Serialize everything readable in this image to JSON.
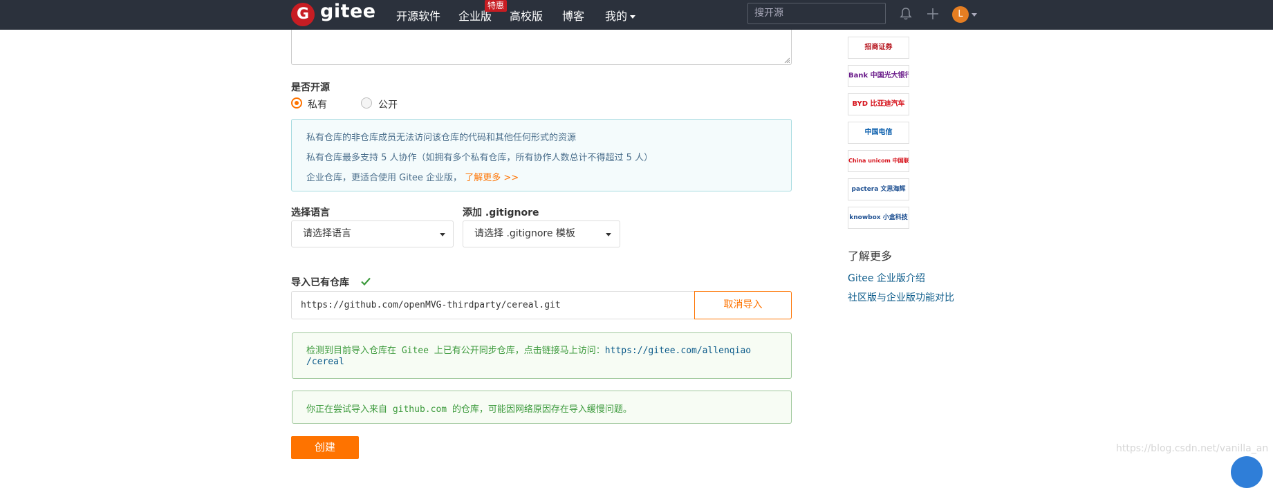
{
  "header": {
    "brand": "gitee",
    "logo_letter": "G",
    "nav": [
      "开源软件",
      "企业版",
      "高校版",
      "博客",
      "我的"
    ],
    "badge": "特惠",
    "search_placeholder": "搜开源",
    "avatar_letter": "L"
  },
  "form": {
    "open_source_label": "是否开源",
    "radio_private": "私有",
    "radio_public": "公开",
    "selected_visibility": "私有",
    "info": {
      "line1": "私有仓库的非仓库成员无法访问该仓库的代码和其他任何形式的资源",
      "line2": "私有仓库最多支持 5 人协作（如拥有多个私有仓库，所有协作人数总计不得超过 5 人）",
      "line3": "企业仓库，更适合使用 Gitee 企业版，",
      "line3_link": "了解更多 >>"
    },
    "language_label": "选择语言",
    "language_value": "请选择语言",
    "gitignore_label": "添加 .gitignore",
    "gitignore_value": "请选择 .gitignore 模板",
    "import_label": "导入已有仓库",
    "import_url": "https://github.com/openMVG-thirdparty/cereal.git",
    "cancel_import": "取消导入",
    "notice1_text": "检测到目前导入仓库在 Gitee 上已有公开同步仓库，点击链接马上访问：",
    "notice1_link_part1": "https://gitee.com/allenqiao",
    "notice1_link_part2": "/cereal",
    "notice2_text": "你正在尝试导入来自 github.com 的仓库，可能因网络原因存在导入缓慢问题。",
    "create_button": "创建"
  },
  "sidebar": {
    "logos": [
      {
        "name": "招商证券",
        "color": "#b5121b"
      },
      {
        "name": "Bank 中国光大银行",
        "color": "#6a1b8a"
      },
      {
        "name": "BYD 比亚迪汽车",
        "color": "#d6121b"
      },
      {
        "name": "中国电信",
        "color": "#0b5fad"
      },
      {
        "name": "China unicom 中国联通",
        "color": "#d6121b"
      },
      {
        "name": "pactera 文思海辉",
        "color": "#1d4f91"
      },
      {
        "name": "knowbox 小盒科技",
        "color": "#1d4f91"
      }
    ],
    "learn_more_title": "了解更多",
    "links": [
      "Gitee 企业版介绍",
      "社区版与企业版功能对比"
    ]
  },
  "watermark": "https://blog.csdn.net/vanilla_an",
  "colors": {
    "accent": "#fe7300",
    "header_bg": "#2b313c",
    "info_border": "#a7dbe0",
    "success_text": "#3c9a3c",
    "link": "#0c5b8a"
  }
}
